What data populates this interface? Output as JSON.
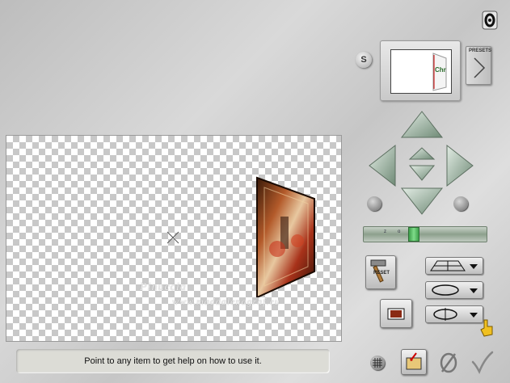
{
  "status_bar": {
    "help_text": "Point to any item to get help on how to use it."
  },
  "presets": {
    "label": "PRESETS"
  },
  "reset": {
    "label": "RESET"
  },
  "s_button": {
    "label": "S"
  },
  "slider": {
    "tick_labels": [
      "z",
      "o",
      "m"
    ]
  },
  "thumbnail": {
    "label": "Chr"
  },
  "watermark": {
    "line1": "Pinuccia",
    "line2": "www.maddalenagraf.eu"
  },
  "icons": {
    "help": "help-icon",
    "arrow_up": "arrow-up-icon",
    "arrow_down": "arrow-down-icon",
    "arrow_left": "arrow-left-icon",
    "arrow_right": "arrow-right-icon",
    "rotate_ccw": "rotate-ccw-icon",
    "rotate_cw": "rotate-cw-icon",
    "grid": "grid-icon",
    "save": "save-icon",
    "cancel": "cancel-icon",
    "ok": "ok-check-icon",
    "pointer": "pointer-hand-icon"
  },
  "colors": {
    "slider_thumb": "#4fbf5a",
    "nav_arrow": "#9fbaa8"
  }
}
